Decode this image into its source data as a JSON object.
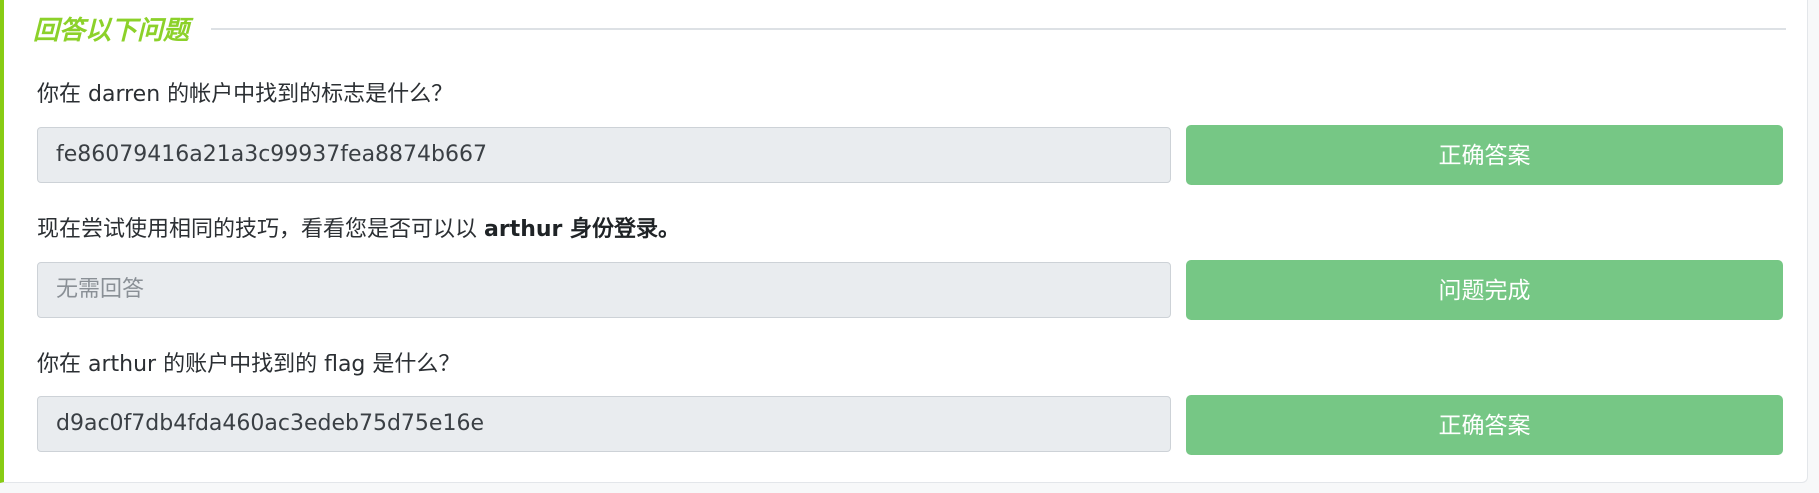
{
  "section": {
    "title": "回答以下问题"
  },
  "questions": [
    {
      "prefix": "你在 ",
      "keyword": "darren",
      "suffix": " 的帐户中找到的标志是什么？",
      "answer_value": "fe86079416a21a3c99937fea8874b667",
      "button_label": "正确答案"
    },
    {
      "prefix": "现在尝试使用相同的技巧，看看您是否可以以 ",
      "keyword": "arthur 身份登录。",
      "suffix": "",
      "answer_placeholder": "无需回答",
      "button_label": "问题完成"
    },
    {
      "prefix": "你在 ",
      "keyword": "arthur",
      "middle": " 的账户中找到的 ",
      "keyword2": "flag",
      "suffix": " 是什么？",
      "answer_value": "d9ac0f7db4fda460ac3edeb75d75e16e",
      "button_label": "正确答案"
    }
  ],
  "colors": {
    "accent": "#88cc14",
    "title": "#8cd12a",
    "button": "#76c785",
    "input_bg": "#e9ecef"
  }
}
